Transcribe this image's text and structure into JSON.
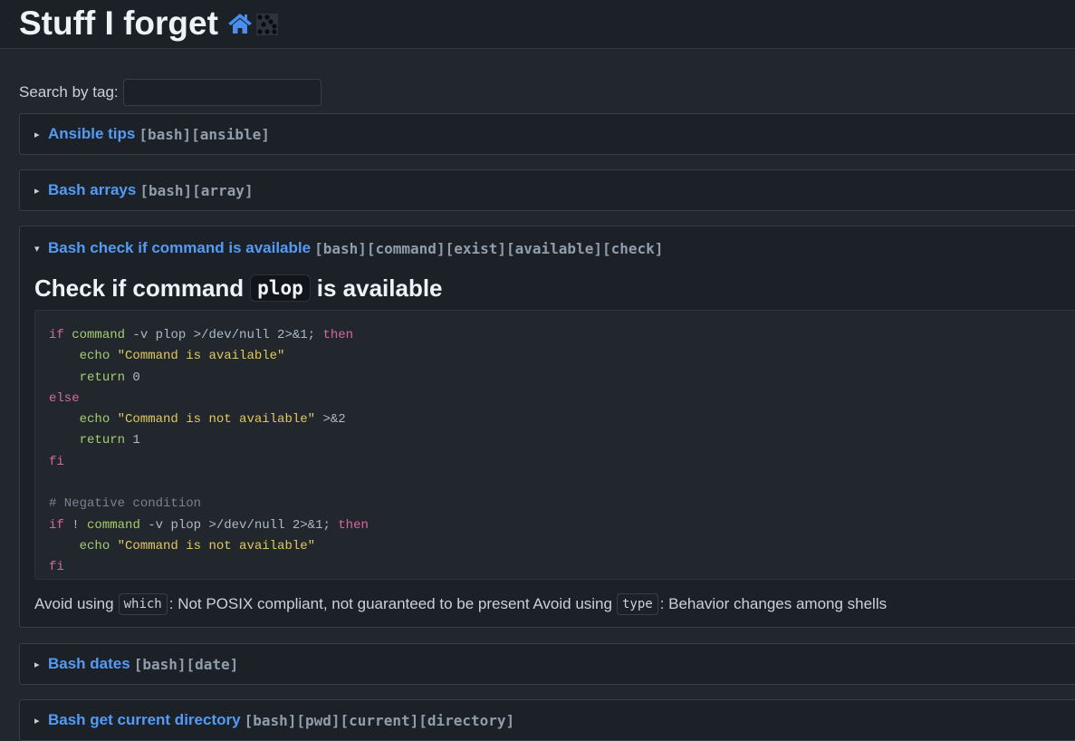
{
  "header": {
    "title": "Stuff I forget",
    "icons": [
      "home-icon",
      "qr-dots-icon"
    ]
  },
  "search": {
    "label": "Search by tag:",
    "value": "",
    "placeholder": ""
  },
  "entries": [
    {
      "title": "Ansible tips",
      "tags": "[bash][ansible]",
      "caret": "▸",
      "expanded": false
    },
    {
      "title": "Bash arrays",
      "tags": "[bash][array]",
      "caret": "▸",
      "expanded": false
    },
    {
      "title": "Bash check if command is available",
      "tags": "[bash][command][exist][available][check]",
      "caret": "▾",
      "expanded": true
    },
    {
      "title": "Bash dates",
      "tags": "[bash][date]",
      "caret": "▸",
      "expanded": false
    },
    {
      "title": "Bash get current directory",
      "tags": "[bash][pwd][current][directory]",
      "caret": "▸",
      "expanded": false
    }
  ],
  "expanded": {
    "heading_before": "Check if command",
    "heading_code": "plop",
    "heading_after": "is available",
    "code_lines": [
      "if command -v plop >/dev/null 2>&1; then",
      "    echo \"Command is available\"",
      "    return 0",
      "else",
      "    echo \"Command is not available\" >&2",
      "    return 1",
      "fi",
      "",
      "# Negative condition",
      "if ! command -v plop >/dev/null 2>&1; then",
      "    echo \"Command is not available\"",
      "fi"
    ],
    "note": {
      "part1": "Avoid using",
      "code1": "which",
      "part2": ": Not POSIX compliant, not guaranteed to be present Avoid using",
      "code2": "type",
      "part3": ": Behavior changes among shells"
    }
  },
  "colors": {
    "link": "#539bf5",
    "tags": "#909dab",
    "keyword": "#d46a9e",
    "builtin": "#a6cc70",
    "string": "#e0c85c",
    "comment": "#768390",
    "home_icon": "#4a8ef0"
  }
}
